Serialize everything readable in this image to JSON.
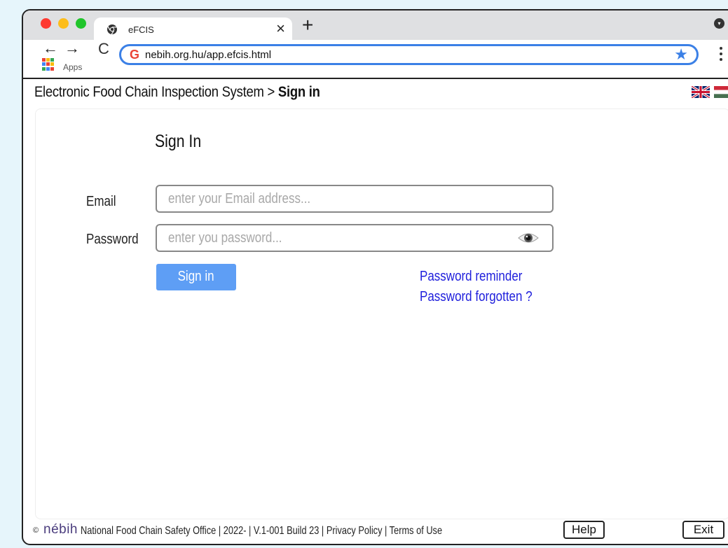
{
  "browser": {
    "tab_title": "eFCIS",
    "tab_close": "×",
    "new_tab": "+",
    "url": "nebih.org.hu/app.efcis.html",
    "apps_label": "Apps",
    "back": "←",
    "forward": "→",
    "reload": "C"
  },
  "header": {
    "breadcrumb_prefix": "Electronic Food Chain Inspection System > ",
    "breadcrumb_current": "Sign in",
    "flags": [
      "uk-flag",
      "hungary-flag"
    ]
  },
  "signin": {
    "title": "Sign In",
    "email_label": "Email",
    "email_placeholder": "enter your Email address...",
    "password_label": "Password",
    "password_placeholder": "enter you password...",
    "signin_button": "Sign in",
    "password_reminder": "Password reminder",
    "password_forgotten": "Password forgotten ?"
  },
  "footer": {
    "copyright": "©",
    "logo_text": "nébih",
    "text": "National Food Chain Safety Office  |  2022-  |  V.1-001 Build 23  |  Privacy Policy  |  Terms of Use",
    "help_button": "Help",
    "exit_button": "Exit"
  },
  "colors": {
    "accent": "#3b80e6",
    "signin_button": "#5e9ef5",
    "link": "#1f1fdc",
    "background": "#e6f5fb"
  }
}
